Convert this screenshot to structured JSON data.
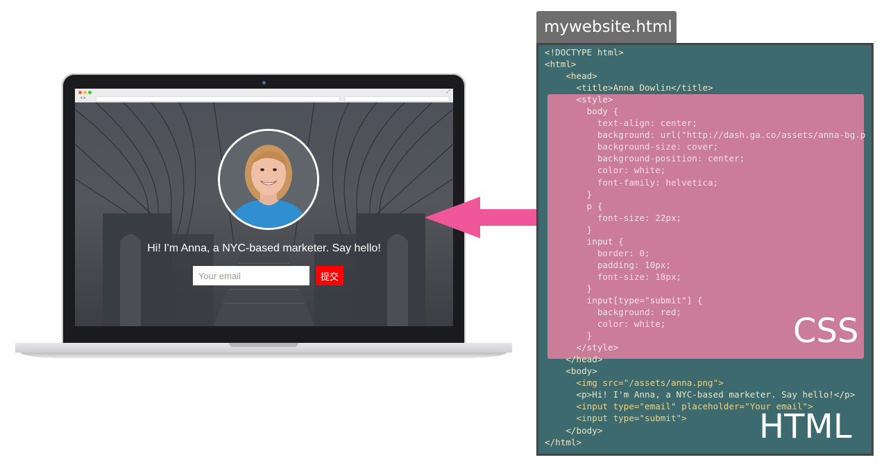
{
  "laptop": {
    "email_placeholder": "Your email",
    "submit_label": "提交",
    "tagline": "Hi! I'm Anna, a NYC-based marketer. Say hello!",
    "accent_color": "#ff0000"
  },
  "arrow": {
    "color": "#f0579a",
    "direction": "left"
  },
  "panel": {
    "file_tab": "mywebsite.html",
    "css_label": "CSS",
    "html_label": "HTML",
    "highlight_color": "#de7e9e",
    "background_color": "#3d6a6e",
    "code_lines": [
      "<!DOCTYPE html>",
      "<html>",
      "    <head>",
      "      <title>Anna Dowlin</title>",
      "      <style>",
      "        body {",
      "          text-align: center;",
      "          background: url(\"http://dash.ga.co/assets/anna-bg.p",
      "          background-size: cover;",
      "          background-position: center;",
      "          color: white;",
      "          font-family: helvetica;",
      "        }",
      "        p {",
      "          font-size: 22px;",
      "        }",
      "        input {",
      "          border: 0;",
      "          padding: 10px;",
      "          font-size: 18px;",
      "        }",
      "        input[type=\"submit\"] {",
      "          background: red;",
      "          color: white;",
      "        }",
      "      </style>",
      "    </head>",
      "    <body>",
      "      <img src=\"/assets/anna.png\">",
      "      <p>Hi! I'm Anna, a NYC-based marketer. Say hello!</p>",
      "      <input type=\"email\" placeholder=\"Your email\">",
      "      <input type=\"submit\">",
      "    </body>",
      "</html>"
    ]
  }
}
